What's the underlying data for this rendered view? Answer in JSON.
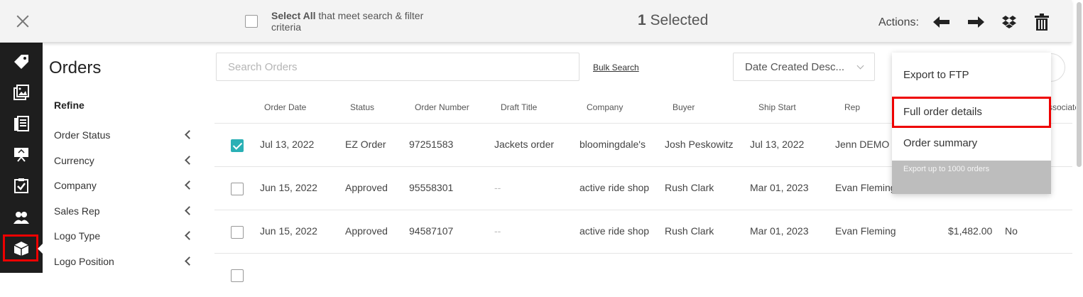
{
  "selection_bar": {
    "select_all_bold": "Select All",
    "select_all_rest": " that meet search & filter criteria",
    "selected_number": "1",
    "selected_word": " Selected",
    "actions_label": "Actions:"
  },
  "sidebar": {
    "title": "Orders",
    "refine": "Refine",
    "filters": [
      {
        "label": "Order Status"
      },
      {
        "label": "Currency"
      },
      {
        "label": "Company"
      },
      {
        "label": "Sales Rep"
      },
      {
        "label": "Logo Type"
      },
      {
        "label": "Logo Position"
      }
    ]
  },
  "search": {
    "placeholder": "Search Orders",
    "bulk_label": "Bulk Search",
    "sort_value": "Date Created Desc..."
  },
  "table": {
    "headers": [
      "Order Date",
      "Status",
      "Order Number",
      "Draft Title",
      "Company",
      "Buyer",
      "Ship Start",
      "Rep",
      "Associate"
    ],
    "rows": [
      {
        "checked": true,
        "date": "Jul 13, 2022",
        "status": "EZ Order",
        "number": "97251583",
        "draft": "Jackets order",
        "company": "bloomingdale's",
        "buyer": "Josh Peskowitz",
        "ship": "Jul 13, 2022",
        "rep": "Jenn DEMO",
        "amount": "",
        "assoc": ""
      },
      {
        "checked": false,
        "date": "Jun 15, 2022",
        "status": "Approved",
        "number": "95558301",
        "draft": "--",
        "company": "active ride shop",
        "buyer": "Rush Clark",
        "ship": "Mar 01, 2023",
        "rep": "Evan Fleming",
        "amount": "",
        "assoc": ""
      },
      {
        "checked": false,
        "date": "Jun 15, 2022",
        "status": "Approved",
        "number": "94587107",
        "draft": "--",
        "company": "active ride shop",
        "buyer": "Rush Clark",
        "ship": "Mar 01, 2023",
        "rep": "Evan Fleming",
        "amount": "$1,482.00",
        "assoc": "No"
      }
    ]
  },
  "menu": {
    "items": [
      {
        "label": "Export to FTP"
      },
      {
        "label": "Full order details"
      },
      {
        "label": "Order summary"
      }
    ],
    "footer": "Export up to 1000 orders"
  },
  "icons": {
    "rail": [
      "tag-icon",
      "images-icon",
      "catalog-icon",
      "presentation-icon",
      "checklist-icon",
      "users-icon",
      "orders-box-icon"
    ],
    "actions": [
      "arrow-left-icon",
      "arrow-right-icon",
      "dropbox-icon",
      "trash-icon"
    ]
  },
  "colors": {
    "accent": "#2ab0b5",
    "highlight": "#ee0000",
    "rail_bg": "#1e1e1e"
  }
}
